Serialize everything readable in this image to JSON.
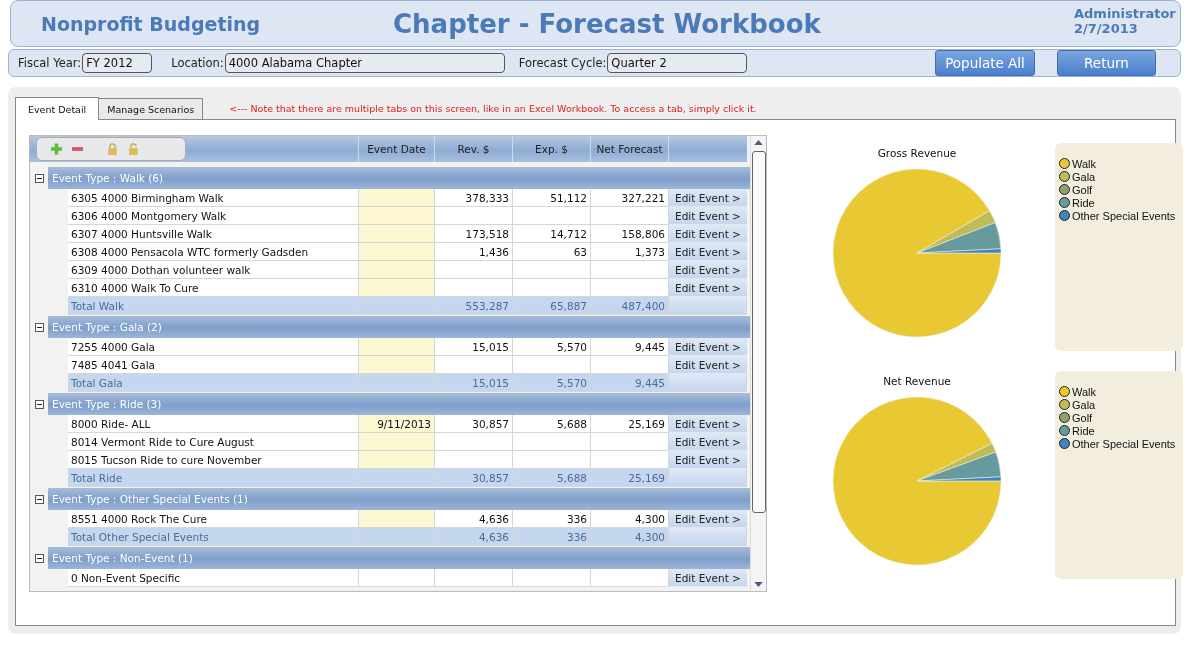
{
  "header": {
    "app_title": "Nonprofit Budgeting",
    "page_title": "Chapter - Forecast Workbook",
    "user": "Administrator",
    "date": "2/7/2013"
  },
  "filters": [
    {
      "label": "Fiscal Year:",
      "value": "FY 2012"
    },
    {
      "label": "Location:",
      "value": "4000 Alabama Chapter"
    },
    {
      "label": "Forecast Cycle:",
      "value": "Quarter 2"
    }
  ],
  "actions": [
    "Populate All",
    "Return"
  ],
  "tabs": [
    {
      "label": "Event Detail",
      "selected": true
    },
    {
      "label": "Manage Scenarios",
      "selected": false
    }
  ],
  "note": "<---  Note that there are multiple tabs on this screen, like in an Excel Workbook. To access a tab, simply click it.",
  "grid": {
    "columns": [
      "Event Date",
      "Rev. $",
      "Exp. $",
      "Net Forecast"
    ],
    "groups": [
      {
        "title": "Event Type : Walk (6)",
        "expanded": true,
        "rows": [
          {
            "name": "6305 4000 Birmingham Walk",
            "date_editable": true,
            "rev": "378,333",
            "exp": "51,112",
            "net": "327,221",
            "action": "Edit Event >"
          },
          {
            "name": "6306 4000 Montgomery Walk",
            "date_editable": true,
            "action": "Edit Event >"
          },
          {
            "name": "6307 4000 Huntsville Walk",
            "date_editable": true,
            "rev": "173,518",
            "exp": "14,712",
            "net": "158,806",
            "action": "Edit Event >"
          },
          {
            "name": "6308 4000 Pensacola WTC formerly Gadsden",
            "date_editable": true,
            "rev": "1,436",
            "exp": "63",
            "net": "1,373",
            "action": "Edit Event >"
          },
          {
            "name": "6309 4000 Dothan volunteer walk",
            "date_editable": true,
            "action": "Edit Event >"
          },
          {
            "name": "6310 4000 Walk To Cure",
            "date_editable": true,
            "action": "Edit Event >"
          }
        ],
        "total": {
          "label": "Total Walk",
          "rev": "553,287",
          "exp": "65,887",
          "net": "487,400"
        }
      },
      {
        "title": "Event Type : Gala (2)",
        "expanded": true,
        "rows": [
          {
            "name": "7255 4000 Gala",
            "date_editable": true,
            "rev": "15,015",
            "exp": "5,570",
            "net": "9,445",
            "action": "Edit Event >"
          },
          {
            "name": "7485 4041 Gala",
            "date_editable": true,
            "action": "Edit Event >"
          }
        ],
        "total": {
          "label": "Total Gala",
          "rev": "15,015",
          "exp": "5,570",
          "net": "9,445"
        }
      },
      {
        "title": "Event Type : Ride (3)",
        "expanded": true,
        "rows": [
          {
            "name": "8000 Ride- ALL",
            "date_editable": true,
            "date": "9/11/2013",
            "rev": "30,857",
            "exp": "5,688",
            "net": "25,169",
            "action": "Edit Event >"
          },
          {
            "name": "8014 Vermont Ride to Cure August",
            "date_editable": true,
            "action": "Edit Event >"
          },
          {
            "name": "8015 Tucson Ride to cure November",
            "date_editable": true,
            "action": "Edit Event >"
          }
        ],
        "total": {
          "label": "Total Ride",
          "rev": "30,857",
          "exp": "5,688",
          "net": "25,169"
        }
      },
      {
        "title": "Event Type : Other Special Events (1)",
        "expanded": true,
        "rows": [
          {
            "name": "8551 4000 Rock The Cure",
            "date_editable": true,
            "rev": "4,636",
            "exp": "336",
            "net": "4,300",
            "action": "Edit Event >"
          }
        ],
        "total": {
          "label": "Total Other Special Events",
          "rev": "4,636",
          "exp": "336",
          "net": "4,300"
        }
      },
      {
        "title": "Event Type : Non-Event (1)",
        "expanded": true,
        "rows": [
          {
            "name": "0 Non-Event Specific",
            "date_editable": false,
            "action": "Edit Event >"
          }
        ]
      }
    ]
  },
  "charts": [
    {
      "chart_data": {
        "type": "pie",
        "title": "Gross Revenue",
        "categories": [
          "Walk",
          "Gala",
          "Golf",
          "Ride",
          "Other Special Events"
        ],
        "values": [
          91.6,
          2.5,
          0,
          5.1,
          0.8
        ]
      },
      "legend": [
        {
          "color": "#e8c934"
        },
        {
          "color": "#c0bb5a"
        },
        {
          "color": "#8da070"
        },
        {
          "color": "#669a9c"
        },
        {
          "color": "#3c85c0"
        }
      ]
    },
    {
      "chart_data": {
        "type": "pie",
        "title": "Net Revenue",
        "categories": [
          "Walk",
          "Gala",
          "Golf",
          "Ride",
          "Other Special Events"
        ],
        "values": [
          92.6,
          1.8,
          0,
          4.8,
          0.8
        ]
      },
      "legend": [
        {
          "color": "#e8c934"
        },
        {
          "color": "#c0bb5a"
        },
        {
          "color": "#8da070"
        },
        {
          "color": "#669a9c"
        },
        {
          "color": "#3c85c0"
        }
      ]
    }
  ]
}
